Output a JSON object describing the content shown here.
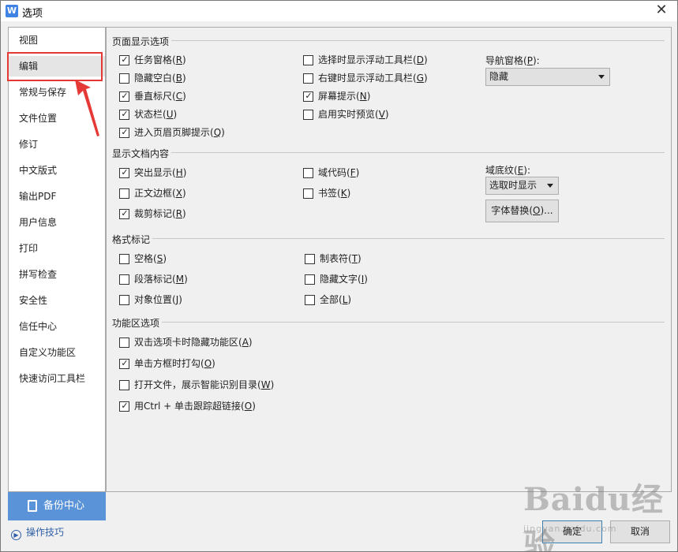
{
  "window": {
    "title": "选项",
    "app_icon_letter": "W",
    "close_glyph": "✕"
  },
  "sidebar": {
    "items": [
      "视图",
      "编辑",
      "常规与保存",
      "文件位置",
      "修订",
      "中文版式",
      "输出PDF",
      "用户信息",
      "打印",
      "拼写检查",
      "安全性",
      "信任中心",
      "自定义功能区",
      "快速访问工具栏"
    ],
    "selected": "编辑"
  },
  "backup": {
    "label": "备份中心"
  },
  "tips": {
    "label": "操作技巧"
  },
  "sections": {
    "page_display": {
      "title": "页面显示选项",
      "left": [
        {
          "text": "任务窗格",
          "key": "R",
          "checked": true
        },
        {
          "text": "隐藏空白",
          "key": "B",
          "checked": false
        },
        {
          "text": "垂直标尺",
          "key": "C",
          "checked": true
        },
        {
          "text": "状态栏",
          "key": "U",
          "checked": true
        },
        {
          "text": "进入页眉页脚提示",
          "key": "Q",
          "checked": true
        }
      ],
      "middle": [
        {
          "text": "选择时显示浮动工具栏",
          "key": "D",
          "checked": false
        },
        {
          "text": "右键时显示浮动工具栏",
          "key": "G",
          "checked": false
        },
        {
          "text": "屏幕提示",
          "key": "N",
          "checked": true
        },
        {
          "text": "启用实时预览",
          "key": "V",
          "checked": false
        }
      ],
      "nav_label": "导航窗格(",
      "nav_key": "P",
      "nav_label_end": "):",
      "nav_value": "隐藏"
    },
    "doc_content": {
      "title": "显示文档内容",
      "left": [
        {
          "text": "突出显示",
          "key": "H",
          "checked": true
        },
        {
          "text": "正文边框",
          "key": "X",
          "checked": false
        },
        {
          "text": "裁剪标记",
          "key": "R",
          "checked": true
        }
      ],
      "middle": [
        {
          "text": "域代码",
          "key": "F",
          "checked": false
        },
        {
          "text": "书签",
          "key": "K",
          "checked": false
        }
      ],
      "shading_label": "域底纹(",
      "shading_key": "E",
      "shading_label_end": "):",
      "shading_value": "选取时显示",
      "font_replace_pre": "字体替换(",
      "font_replace_key": "O",
      "font_replace_post": ")..."
    },
    "format_marks": {
      "title": "格式标记",
      "left": [
        {
          "text": "空格",
          "key": "S",
          "checked": false
        },
        {
          "text": "段落标记",
          "key": "M",
          "checked": false
        },
        {
          "text": "对象位置",
          "key": "J",
          "checked": false
        }
      ],
      "middle": [
        {
          "text": "制表符",
          "key": "T",
          "checked": false
        },
        {
          "text": "隐藏文字",
          "key": "I",
          "checked": false
        },
        {
          "text": "全部",
          "key": "L",
          "checked": false
        }
      ]
    },
    "ribbon": {
      "title": "功能区选项",
      "items": [
        {
          "text": "双击选项卡时隐藏功能区",
          "key": "A",
          "checked": false
        },
        {
          "text": "单击方框时打勾",
          "key": "O",
          "checked": true
        },
        {
          "text": "打开文件，展示智能识别目录",
          "key": "W",
          "checked": false
        },
        {
          "text": "用Ctrl + 单击跟踪超链接",
          "key": "O",
          "checked": true
        }
      ]
    }
  },
  "footer": {
    "ok_label": "确定",
    "cancel_label": "取消"
  },
  "watermark": {
    "text": "Baidu经验",
    "sub": "jingyan.baidu.com"
  },
  "colors": {
    "highlight_box": "#e53935",
    "backup_bg": "#5b93d8",
    "app_icon": "#3f84e5"
  },
  "icons": {
    "checkbox_tick": "✓",
    "dropdown": "chevron-down-icon",
    "annotation_arrow": "red-arrow-icon"
  }
}
